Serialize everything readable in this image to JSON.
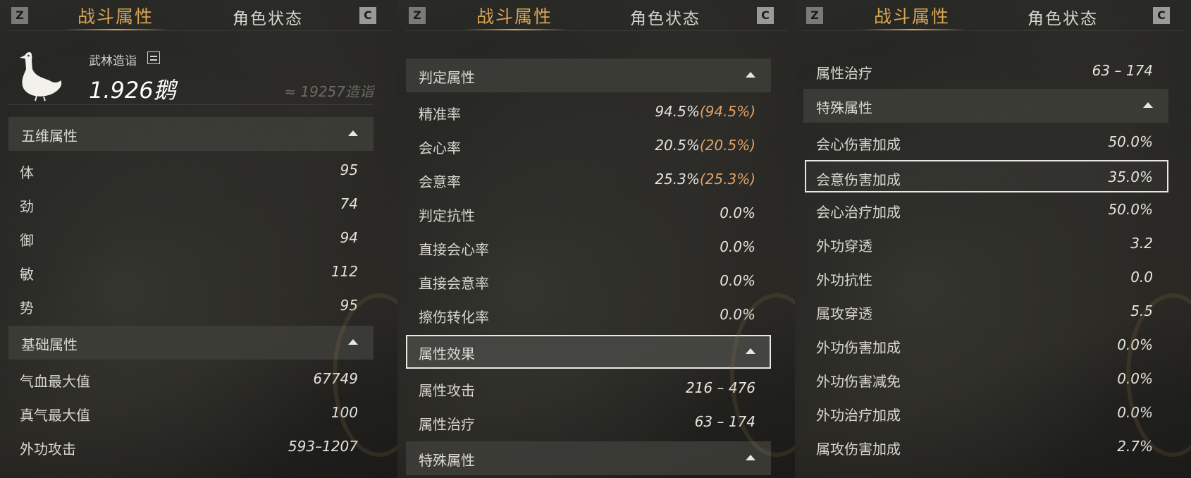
{
  "tabs": {
    "left_key": "Z",
    "right_key": "C",
    "combat_attributes": "战斗属性",
    "character_status": "角色状态"
  },
  "character": {
    "rank_label": "武林造诣",
    "rank_value": "1.926鹅",
    "rank_approx": "≈ 19257造诣"
  },
  "panel1": {
    "five_dim": {
      "title": "五维属性",
      "rows": [
        {
          "label": "体",
          "value": "95"
        },
        {
          "label": "劲",
          "value": "74"
        },
        {
          "label": "御",
          "value": "94"
        },
        {
          "label": "敏",
          "value": "112"
        },
        {
          "label": "势",
          "value": "95"
        }
      ]
    },
    "basic": {
      "title": "基础属性",
      "rows": [
        {
          "label": "气血最大值",
          "value": "67749"
        },
        {
          "label": "真气最大值",
          "value": "100"
        },
        {
          "label": "外功攻击",
          "value": "593–1207"
        }
      ]
    }
  },
  "panel2": {
    "judgement": {
      "title": "判定属性",
      "rows": [
        {
          "label": "精准率",
          "value": "94.5%",
          "extra": "(94.5%)"
        },
        {
          "label": "会心率",
          "value": "20.5%",
          "extra": "(20.5%)"
        },
        {
          "label": "会意率",
          "value": "25.3%",
          "extra": "(25.3%)"
        },
        {
          "label": "判定抗性",
          "value": "0.0%",
          "extra": ""
        },
        {
          "label": "直接会心率",
          "value": "0.0%",
          "extra": ""
        },
        {
          "label": "直接会意率",
          "value": "0.0%",
          "extra": ""
        },
        {
          "label": "擦伤转化率",
          "value": "0.0%",
          "extra": ""
        }
      ]
    },
    "effects": {
      "title": "属性效果",
      "rows": [
        {
          "label": "属性攻击",
          "value": "216 – 476"
        },
        {
          "label": "属性治疗",
          "value": "63 – 174"
        }
      ]
    },
    "special": {
      "title": "特殊属性"
    }
  },
  "panel3": {
    "top_row": {
      "label": "属性治疗",
      "value": "63 – 174"
    },
    "special": {
      "title": "特殊属性",
      "rows": [
        {
          "label": "会心伤害加成",
          "value": "50.0%"
        },
        {
          "label": "会意伤害加成",
          "value": "35.0%"
        },
        {
          "label": "会心治疗加成",
          "value": "50.0%"
        },
        {
          "label": "外功穿透",
          "value": "3.2"
        },
        {
          "label": "外功抗性",
          "value": "0.0"
        },
        {
          "label": "属攻穿透",
          "value": "5.5"
        },
        {
          "label": "外功伤害加成",
          "value": "0.0%"
        },
        {
          "label": "外功伤害减免",
          "value": "0.0%"
        },
        {
          "label": "外功治疗加成",
          "value": "0.0%"
        },
        {
          "label": "属攻伤害加成",
          "value": "2.7%"
        }
      ]
    }
  },
  "colors": {
    "accent_gold": "#d8a451",
    "highlight_orange": "#e0a36a"
  }
}
